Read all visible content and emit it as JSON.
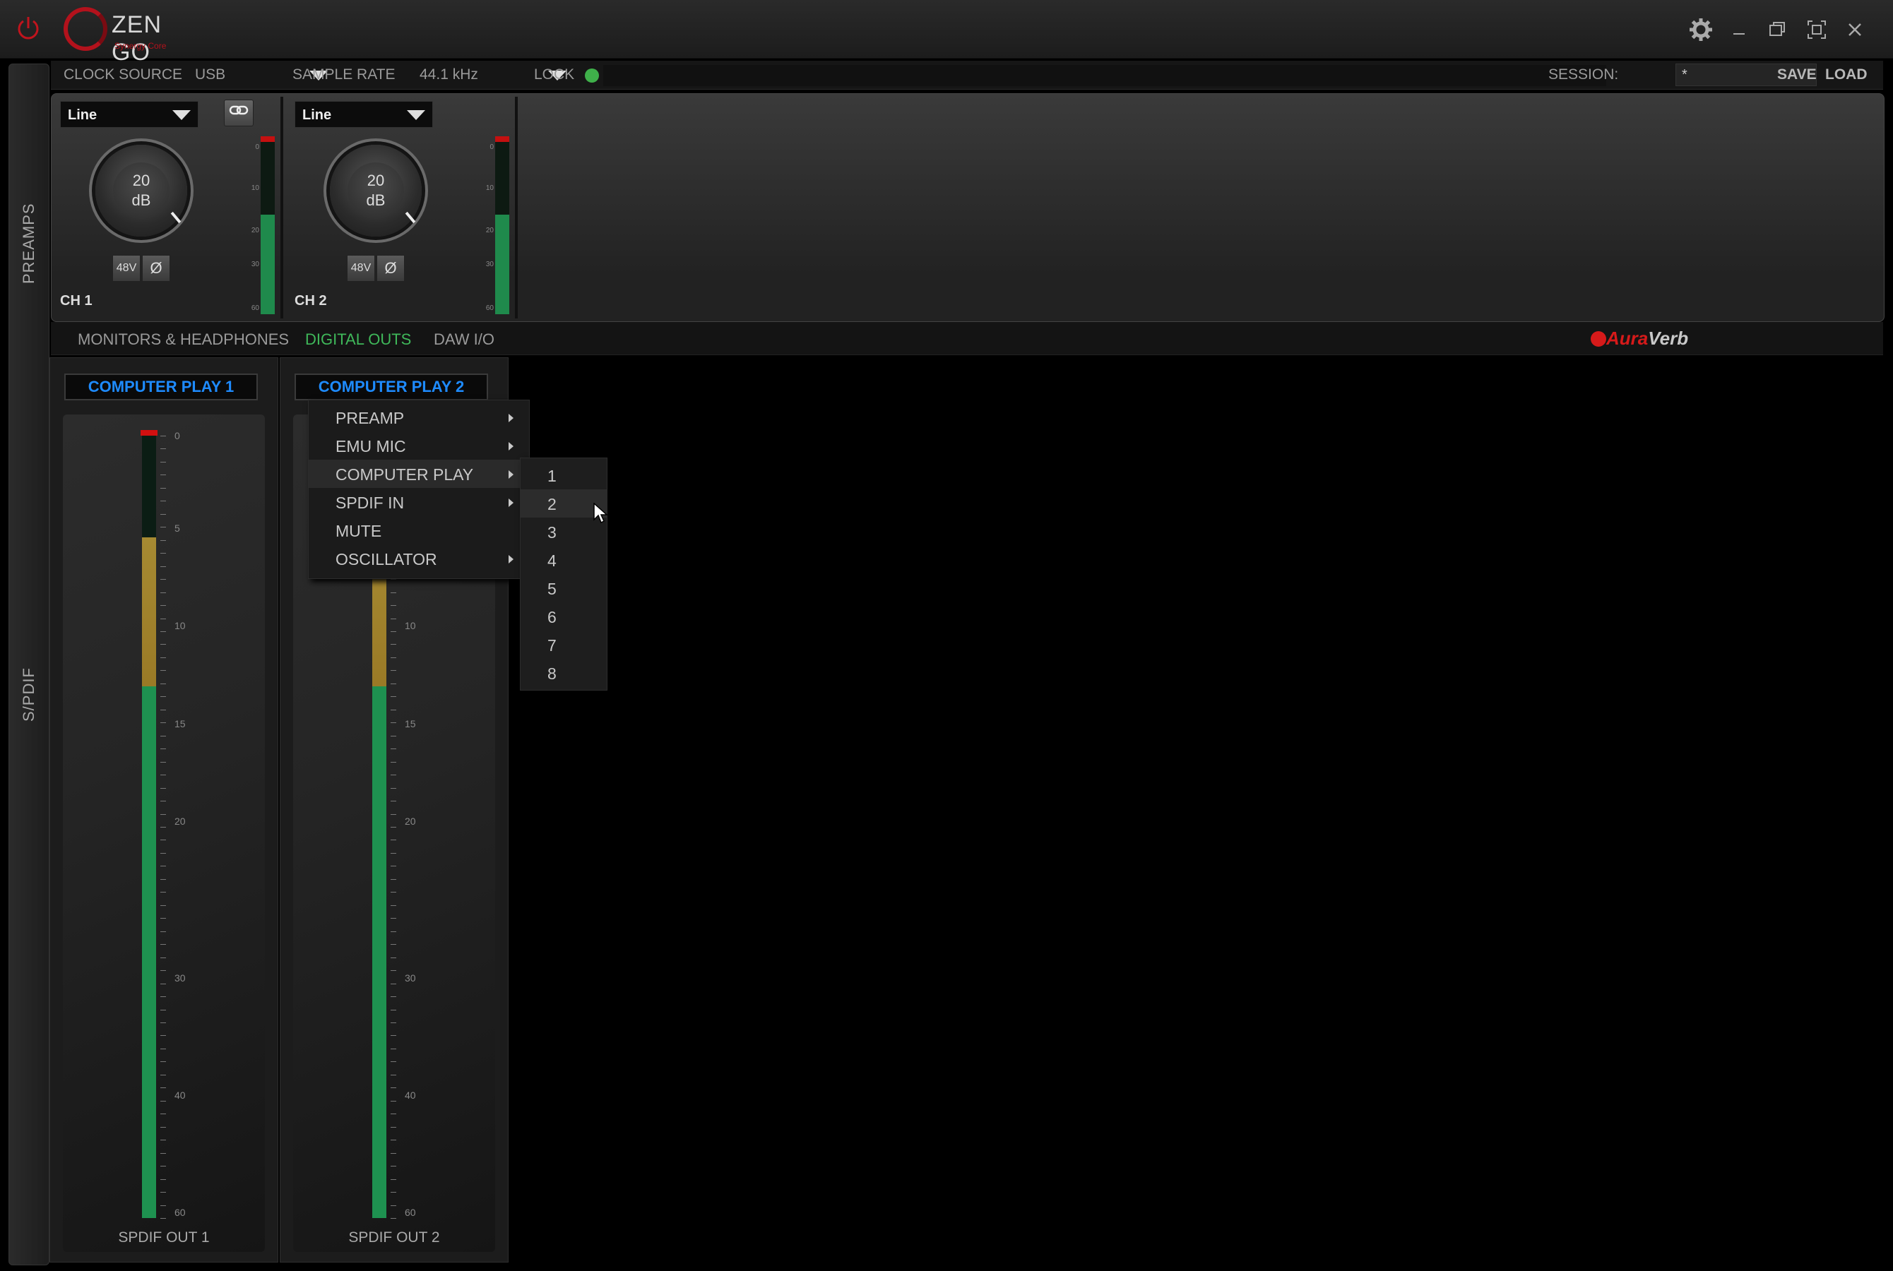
{
  "titlebar": {
    "app_name": "ZEN GO",
    "app_sub": "Synergy Core"
  },
  "rail": {
    "preamps_label": "PREAMPS",
    "spdif_label": "S/PDIF"
  },
  "topbar": {
    "clock_source_label": "CLOCK SOURCE",
    "clock_source_value": "USB",
    "sample_rate_label": "SAMPLE  RATE",
    "sample_rate_value": "44.1 kHz",
    "lock_label": "LOCK",
    "session_label": "SESSION:",
    "session_value": "*",
    "save_label": "SAVE",
    "load_label": "LOAD"
  },
  "preamps": {
    "channels": [
      {
        "input": "Line",
        "gain_value": "20",
        "gain_unit": "dB",
        "phantom": "48V",
        "phase": "Ø",
        "name": "CH 1"
      },
      {
        "input": "Line",
        "gain_value": "20",
        "gain_unit": "dB",
        "phantom": "48V",
        "phase": "Ø",
        "name": "CH 2"
      }
    ],
    "meter_scale": [
      "0",
      "10",
      "20",
      "30",
      "60"
    ],
    "meter_level": 0.56
  },
  "tabs": {
    "monitors": "MONITORS & HEADPHONES",
    "digital_outs": "DIGITAL OUTS",
    "daw_io": "DAW I/O",
    "brand_a": "Aura",
    "brand_b": "Verb"
  },
  "outputs": [
    {
      "source": "COMPUTER PLAY 1",
      "name": "SPDIF OUT 1"
    },
    {
      "source": "COMPUTER PLAY 2",
      "name": "SPDIF OUT 2"
    }
  ],
  "out_meter_scale": [
    "0",
    "5",
    "10",
    "15",
    "20",
    "30",
    "40",
    "60"
  ],
  "out_meter": {
    "green_level": 0.68,
    "yellow_level": 0.19
  },
  "context_menu": {
    "items": [
      {
        "label": "PREAMP",
        "submenu": true
      },
      {
        "label": "EMU MIC",
        "submenu": true
      },
      {
        "label": "COMPUTER PLAY",
        "submenu": true
      },
      {
        "label": "SPDIF IN",
        "submenu": true
      },
      {
        "label": "MUTE",
        "submenu": false
      },
      {
        "label": "OSCILLATOR",
        "submenu": true
      }
    ],
    "highlighted": "COMPUTER PLAY",
    "submenu_items": [
      "1",
      "2",
      "3",
      "4",
      "5",
      "6",
      "7",
      "8"
    ],
    "submenu_highlighted": "2"
  },
  "colors": {
    "accent_red": "#b3121c",
    "active_tab_green": "#3fb85a",
    "source_blue": "#1e8bff",
    "meter_green": "#1e9150",
    "meter_yellow": "#a68a32",
    "clip_red": "#d21010",
    "lock_led": "#3fb04a"
  },
  "icons": [
    "power-icon",
    "gear-icon",
    "minimize-icon",
    "restore-icon",
    "fullscreen-icon",
    "close-icon",
    "link-icon",
    "dropdown-arrow-icon",
    "submenu-arrow-icon",
    "cursor-icon"
  ]
}
